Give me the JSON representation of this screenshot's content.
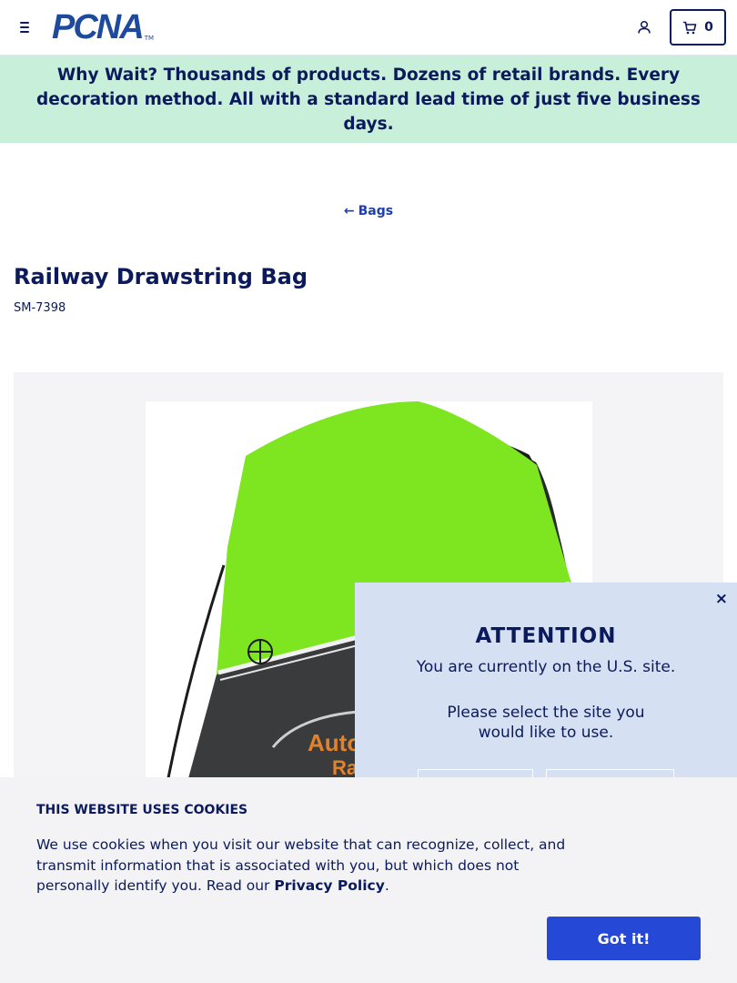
{
  "header": {
    "logo_text": "PCNA",
    "logo_tm": "TM",
    "cart_count": "0"
  },
  "promo": {
    "lead": "Why Wait?",
    "text": " Thousands of products. Dozens of retail brands. Every decoration method. All with a standard lead time of just five business days."
  },
  "breadcrumb": {
    "back_label": "Bags"
  },
  "product": {
    "title": "Railway Drawstring Bag",
    "sku": "SM-7398",
    "imprint_text_1": "Auto",
    "imprint_text_2": "Ra"
  },
  "attention_modal": {
    "close_label": "×",
    "title": "ATTENTION",
    "message": "You are currently on the U.S. site.",
    "prompt": "Please select the site you would like to use."
  },
  "cookie_banner": {
    "title": "THIS WEBSITE USES COOKIES",
    "body": "We use cookies when you visit our website that can recognize, collect, and transmit information that is associated with you, but which does not personally identify you. Read our ",
    "link_label": "Privacy Policy",
    "body_end": ".",
    "accept_label": "Got it!"
  },
  "colors": {
    "navy": "#0b1a5c",
    "promo_bg": "#c8efd9",
    "link_blue": "#1e3fae",
    "accept_blue": "#2548d6",
    "modal_bg": "#d5e0f3",
    "bag_green": "#7ee521",
    "bag_black": "#3a3b3d"
  }
}
